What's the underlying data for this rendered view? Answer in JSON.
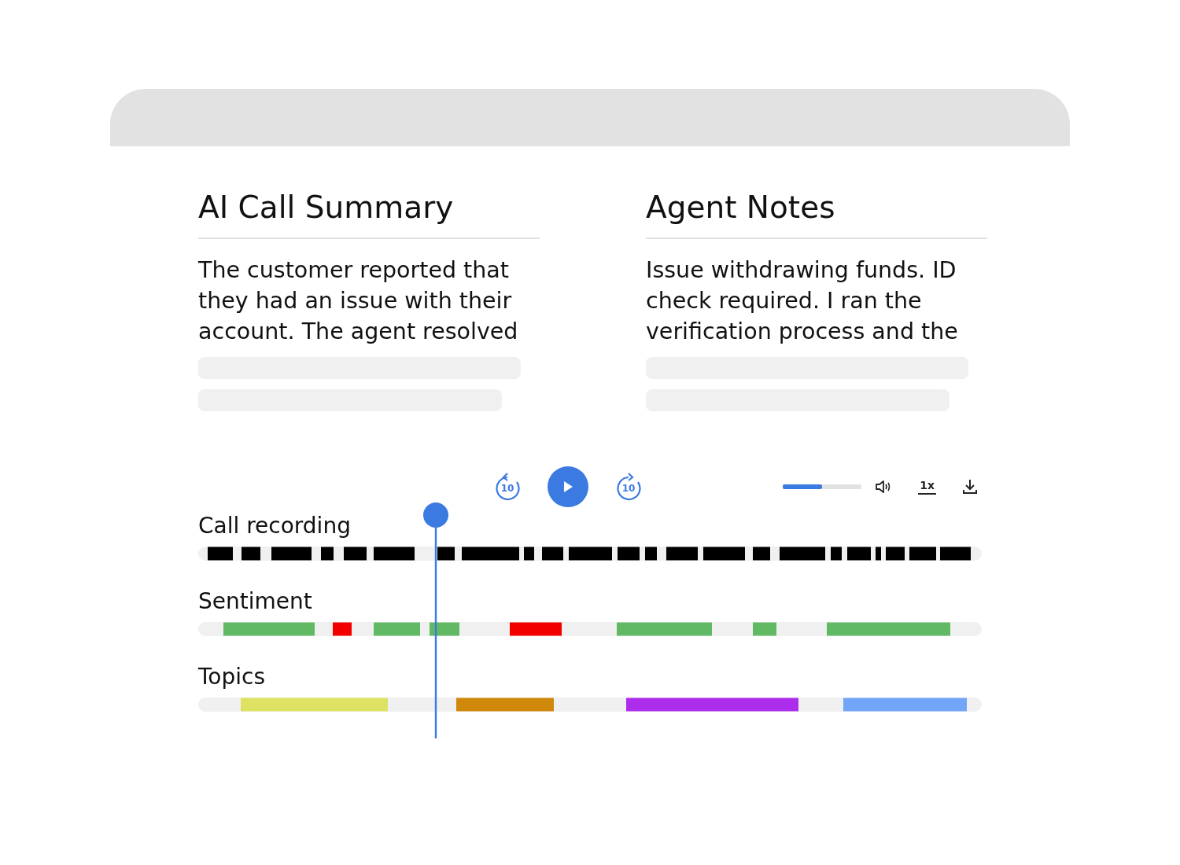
{
  "columns": [
    {
      "title": "AI Call Summary",
      "text": "The customer reported that they had an issue with their account. The agent resolved"
    },
    {
      "title": "Agent Notes",
      "text": "Issue withdrawing funds. ID check required. I ran the verification process and the"
    }
  ],
  "player": {
    "rewind_label": "10",
    "forward_label": "10",
    "speed": "1x",
    "volume": {
      "level": 0.5
    }
  },
  "tracks": [
    {
      "label": "Call recording",
      "kind": "waveform"
    },
    {
      "label": "Sentiment",
      "kind": "sentiment"
    },
    {
      "label": "Topics",
      "kind": "topics"
    }
  ]
}
